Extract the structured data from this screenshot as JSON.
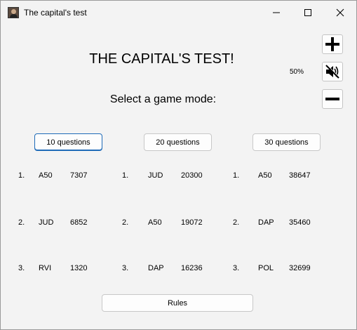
{
  "window": {
    "title": "The capital's test",
    "icon": "app-portrait-icon"
  },
  "main": {
    "heading": "THE CAPITAL'S TEST!",
    "subheading": "Select a game mode:",
    "volume_label": "50%"
  },
  "side_controls": {
    "icons": [
      "plus-icon",
      "mute-icon",
      "minus-icon"
    ]
  },
  "modes": [
    {
      "label": "10 questions",
      "active": true
    },
    {
      "label": "20 questions",
      "active": false
    },
    {
      "label": "30 questions",
      "active": false
    }
  ],
  "leaderboards": [
    [
      {
        "rank": "1.",
        "name": "A50",
        "score": "7307"
      },
      {
        "rank": "2.",
        "name": "JUD",
        "score": "6852"
      },
      {
        "rank": "3.",
        "name": "RVI",
        "score": "1320"
      }
    ],
    [
      {
        "rank": "1.",
        "name": "JUD",
        "score": "20300"
      },
      {
        "rank": "2.",
        "name": "A50",
        "score": "19072"
      },
      {
        "rank": "3.",
        "name": "DAP",
        "score": "16236"
      }
    ],
    [
      {
        "rank": "1.",
        "name": "A50",
        "score": "38647"
      },
      {
        "rank": "2.",
        "name": "DAP",
        "score": "35460"
      },
      {
        "rank": "3.",
        "name": "POL",
        "score": "32699"
      }
    ]
  ],
  "footer": {
    "rules_label": "Rules"
  },
  "colors": {
    "background": "#f3f3f3",
    "button_bg": "#fdfdfd",
    "button_border": "#c8c8c8",
    "active_border": "#1f6bb8"
  }
}
